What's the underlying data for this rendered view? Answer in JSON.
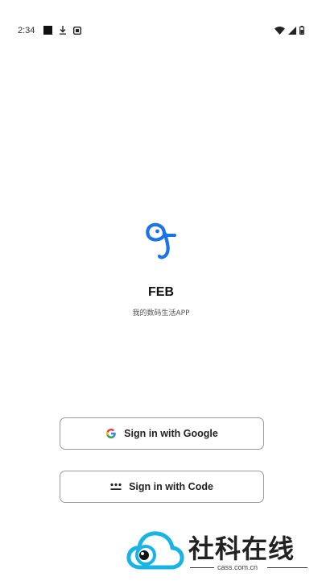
{
  "status_bar": {
    "time": "2:34",
    "left_icons": [
      "stop-square-icon",
      "download-icon",
      "notification-icon"
    ],
    "right_icons": [
      "wifi-icon",
      "cell-signal-icon",
      "battery-icon"
    ]
  },
  "app": {
    "logo_icon": "feb-logo-icon",
    "name": "FEB",
    "tagline": "我的数码生活APP",
    "brand_color": "#1a73e8"
  },
  "buttons": {
    "google_label": "Sign in with Google",
    "code_label": "Sign in with Code"
  },
  "watermark": {
    "title": "社科在线",
    "url": "cass.com.cn"
  },
  "colors": {
    "google_blue": "#4285F4",
    "google_red": "#EA4335",
    "google_yellow": "#FBBC05",
    "google_green": "#34A853",
    "watermark_cyan": "#1ab3e6"
  }
}
